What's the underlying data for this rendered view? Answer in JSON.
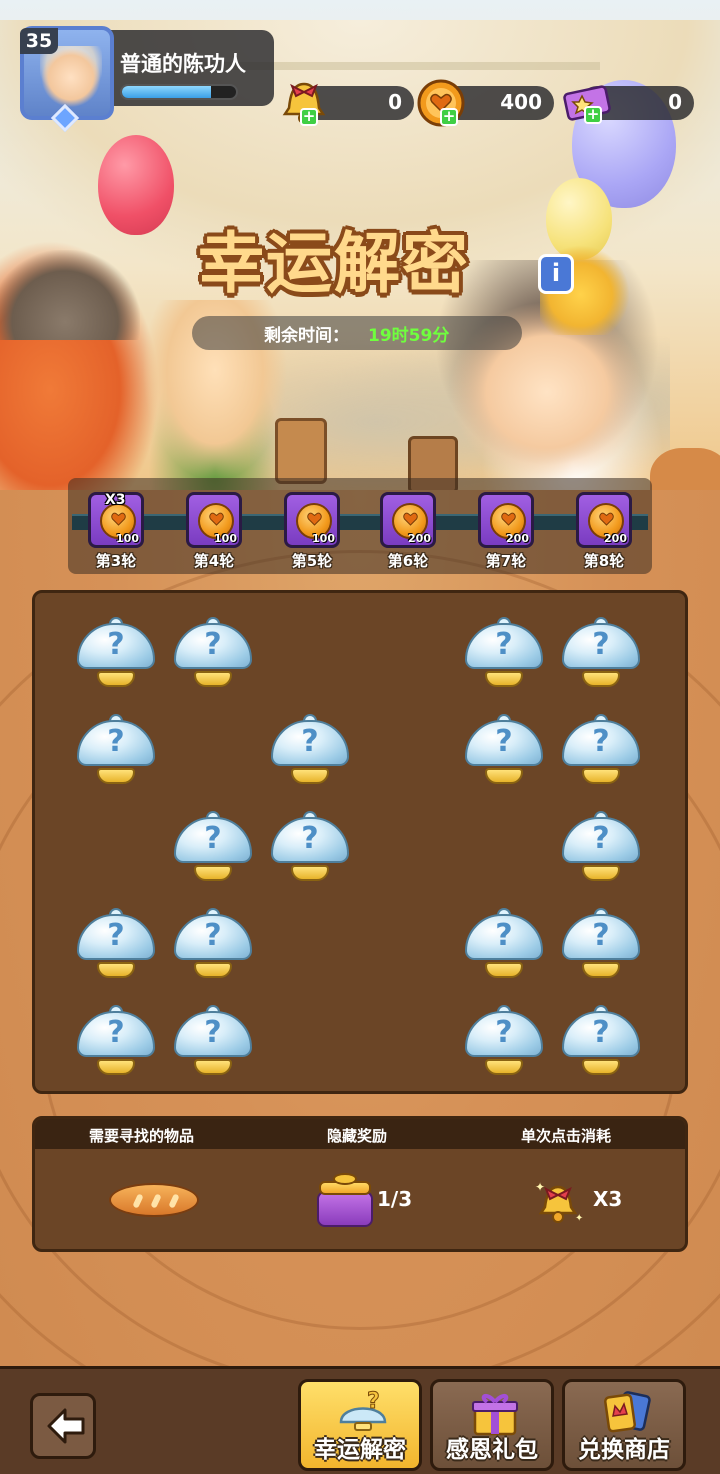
{
  "player": {
    "level": "35",
    "name": "普通的陈功人",
    "exp_fraction": 0.78
  },
  "resources": [
    {
      "icon": "bell-icon",
      "value": "0"
    },
    {
      "icon": "heart-coin-icon",
      "value": "400"
    },
    {
      "icon": "ticket-icon",
      "value": "0"
    }
  ],
  "event": {
    "title": "幸运解密",
    "timer_label": "剩余时间：",
    "timer_value": "19时59分"
  },
  "rounds": [
    {
      "label": "第3轮",
      "amount": "100",
      "multiplier": "X3"
    },
    {
      "label": "第4轮",
      "amount": "100",
      "multiplier": ""
    },
    {
      "label": "第5轮",
      "amount": "100",
      "multiplier": ""
    },
    {
      "label": "第6轮",
      "amount": "200",
      "multiplier": ""
    },
    {
      "label": "第7轮",
      "amount": "200",
      "multiplier": ""
    },
    {
      "label": "第8轮",
      "amount": "200",
      "multiplier": ""
    }
  ],
  "board": {
    "cloche_symbol": "?",
    "cells": [
      [
        1,
        1,
        0,
        0,
        1,
        1
      ],
      [
        1,
        0,
        1,
        0,
        1,
        1
      ],
      [
        0,
        1,
        1,
        0,
        0,
        1
      ],
      [
        1,
        1,
        0,
        0,
        1,
        1
      ],
      [
        1,
        1,
        0,
        0,
        1,
        1
      ]
    ]
  },
  "info": {
    "headers": {
      "find": "需要寻找的物品",
      "hidden": "隐藏奖励",
      "cost": "单次点击消耗"
    },
    "find_item": "bread-icon",
    "hidden_count": "1/3",
    "cost_value": "X3"
  },
  "nav": {
    "back_icon": "back-arrow-icon",
    "buttons": [
      {
        "label": "幸运解密",
        "icon": "cloche-icon",
        "active": true
      },
      {
        "label": "感恩礼包",
        "icon": "gift-icon",
        "active": false
      },
      {
        "label": "兑换商店",
        "icon": "shop-cards-icon",
        "active": false
      }
    ]
  },
  "colors": {
    "accent_green": "#6fff3e",
    "board_brown": "#6b4526",
    "title_gold": "#ffd98c"
  }
}
